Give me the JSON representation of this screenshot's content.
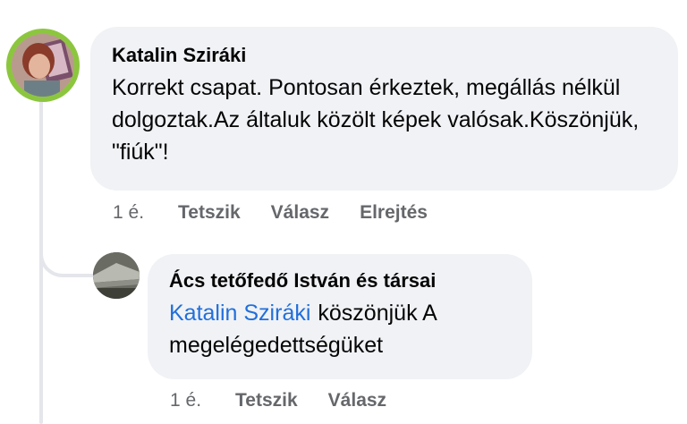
{
  "comment": {
    "author": "Katalin Sziráki",
    "text": "Korrekt csapat. Pontosan érkeztek, megállás nélkül dolgoztak.Az általuk közölt képek valósak.Köszönjük, \"fiúk\"!",
    "time": "1 é.",
    "actions": {
      "like": "Tetszik",
      "reply": "Válasz",
      "hide": "Elrejtés"
    }
  },
  "reply": {
    "author": "Ács tetőfedő István és társai",
    "mention": "Katalin Sziráki",
    "text": "köszönjük  A megelégedettségüket",
    "time": "1 é.",
    "actions": {
      "like": "Tetszik",
      "reply": "Válasz"
    }
  },
  "colors": {
    "bubble": "#f0f2f5",
    "mention": "#216fdb",
    "meta": "#65676b"
  }
}
